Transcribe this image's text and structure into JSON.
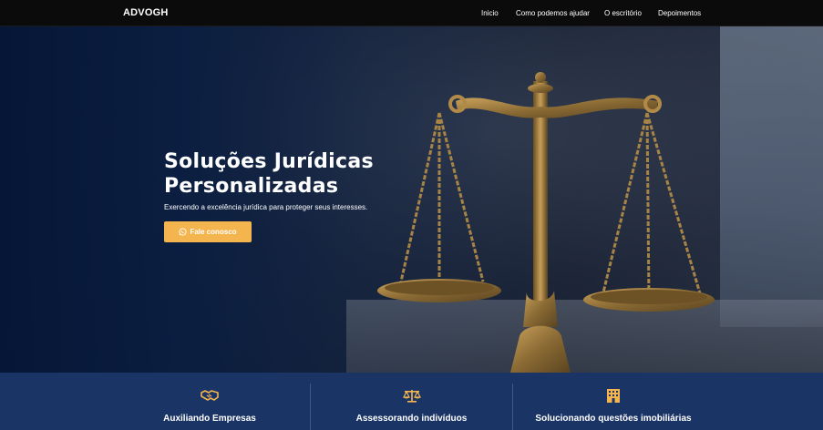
{
  "nav": {
    "brand": "ADVOGH",
    "links": [
      "Inicio",
      "Como podemos ajudar",
      "O escritório",
      "Depoimentos"
    ]
  },
  "hero": {
    "title": "Soluções Jurídicas Personalizadas",
    "subtitle": "Exercendo a excelência jurídica para proteger seus interesses.",
    "cta_label": "Fale conosco"
  },
  "services": [
    {
      "label": "Auxiliando Empresas",
      "icon": "handshake-icon"
    },
    {
      "label": "Assessorando indivíduos",
      "icon": "scale-icon"
    },
    {
      "label": "Solucionando questões imobiliárias",
      "icon": "building-icon"
    }
  ],
  "colors": {
    "accent": "#f5b54e",
    "navbar": "#0b0b0b",
    "services_bar": "#1b3466",
    "hero_overlay": "#0a1e42"
  }
}
